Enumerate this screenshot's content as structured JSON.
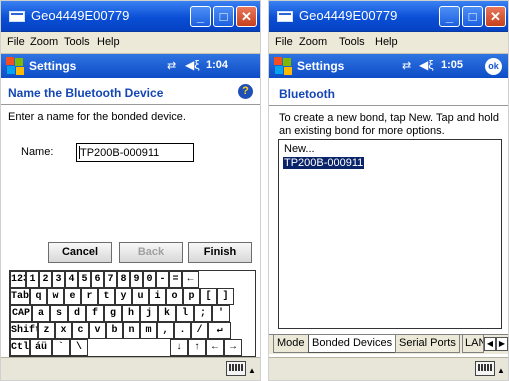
{
  "left": {
    "window_title": "Geo4449E00779",
    "menu": [
      "File",
      "Zoom",
      "Tools",
      "Help"
    ],
    "nav_title": "Settings",
    "time": "1:04",
    "heading": "Name the Bluetooth Device",
    "instruction": "Enter a name for the bonded device.",
    "name_label": "Name:",
    "name_value": "TP200B-000911",
    "buttons": {
      "cancel": "Cancel",
      "back": "Back",
      "finish": "Finish"
    },
    "keyboard": {
      "row1": [
        "123",
        "1",
        "2",
        "3",
        "4",
        "5",
        "6",
        "7",
        "8",
        "9",
        "0",
        "-",
        "=",
        "←"
      ],
      "row2": [
        "Tab",
        "q",
        "w",
        "e",
        "r",
        "t",
        "y",
        "u",
        "i",
        "o",
        "p",
        "[",
        "]"
      ],
      "row3": [
        "CAP",
        "a",
        "s",
        "d",
        "f",
        "g",
        "h",
        "j",
        "k",
        "l",
        ";",
        "'"
      ],
      "row4": [
        "Shift",
        "z",
        "x",
        "c",
        "v",
        "b",
        "n",
        "m",
        ",",
        ".",
        "/",
        "↵"
      ],
      "row5": [
        "Ctl",
        "áü",
        "`",
        "\\",
        "↓",
        "↑",
        "←",
        "→"
      ]
    }
  },
  "right": {
    "window_title": "Geo4449E00779",
    "menu": [
      "File",
      "Zoom",
      "Tools",
      "Help"
    ],
    "nav_title": "Settings",
    "time": "1:05",
    "ok_label": "ok",
    "heading": "Bluetooth",
    "instruction_line1": "To create a new bond, tap New. Tap and hold",
    "instruction_line2": "an existing bond for more options.",
    "list_items": [
      "New...",
      "TP200B-000911"
    ],
    "tabs": [
      "Mode",
      "Bonded Devices",
      "Serial Ports",
      "LAN"
    ]
  },
  "icons": {
    "title_icon": "window-icon",
    "minimize": "minimize-icon",
    "maximize": "maximize-icon",
    "close": "close-icon",
    "start": "windows-start-icon",
    "connectivity": "connectivity-icon",
    "volume": "volume-icon",
    "help": "help-icon",
    "keyboard": "keyboard-icon"
  },
  "colors": {
    "titlebar": "#0a4fd6",
    "navbar": "#1a5cd4",
    "heading": "#1446b4",
    "selection": "#0a246a"
  }
}
